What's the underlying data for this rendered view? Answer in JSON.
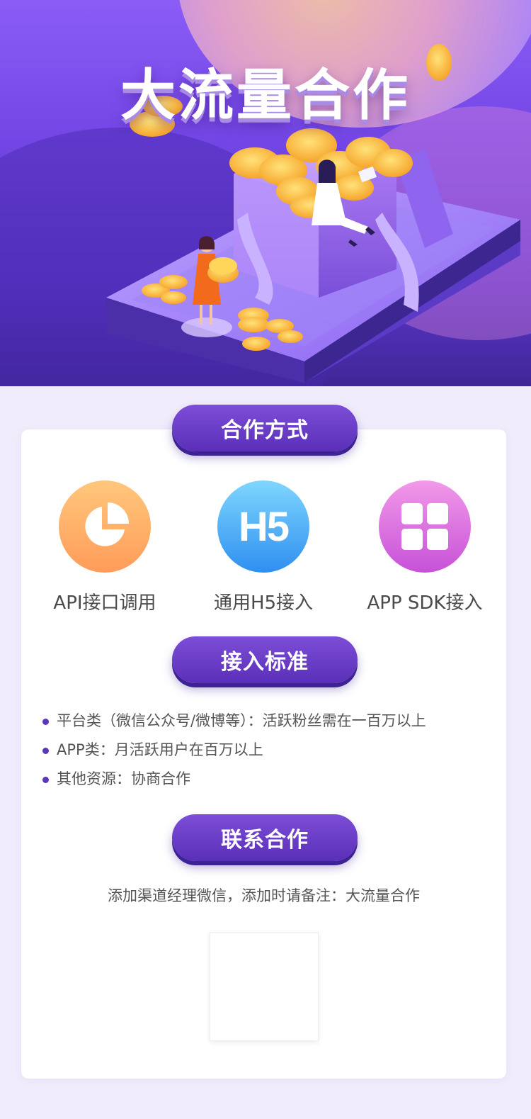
{
  "hero": {
    "title": "大流量合作"
  },
  "sections": {
    "methods_title": "合作方式",
    "standards_title": "接入标准",
    "contact_title": "联系合作"
  },
  "methods": [
    {
      "icon": "pie-chart-icon",
      "label": "API接口调用"
    },
    {
      "icon": "h5-icon",
      "icon_text": "H5",
      "label": "通用H5接入"
    },
    {
      "icon": "app-grid-icon",
      "label": "APP SDK接入"
    }
  ],
  "standards": [
    "平台类（微信公众号/微博等）：活跃粉丝需在一百万以上",
    "APP类：月活跃用户在百万以上",
    "其他资源：协商合作"
  ],
  "contact": {
    "text": "添加渠道经理微信，添加时请备注：大流量合作"
  },
  "colors": {
    "accent": "#5a2fb8",
    "page_bg": "#f0ecfb",
    "hero_top": "#8b5cf6",
    "hero_bottom": "#3f2796"
  }
}
